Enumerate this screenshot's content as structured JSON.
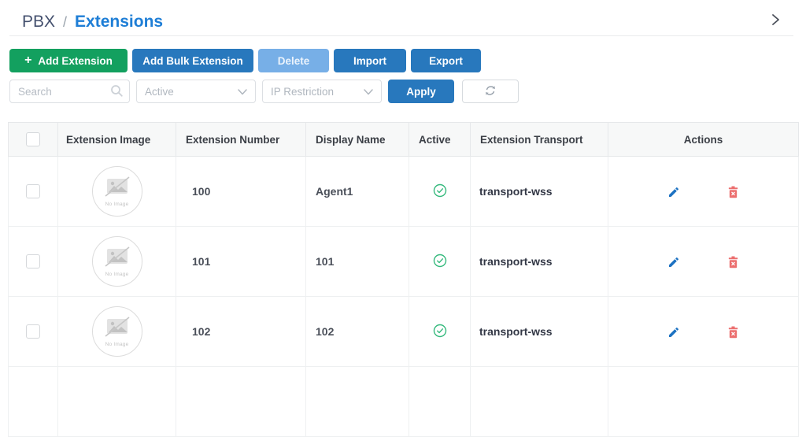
{
  "breadcrumb": {
    "parent": "PBX",
    "separator": "/",
    "current": "Extensions"
  },
  "toolbar": {
    "add_extension_label": "Add Extension",
    "add_bulk_extension_label": "Add Bulk Extension",
    "delete_label": "Delete",
    "import_label": "Import",
    "export_label": "Export"
  },
  "filters": {
    "search_placeholder": "Search",
    "status_selected": "Active",
    "ip_restriction_selected": "IP Restriction",
    "apply_label": "Apply"
  },
  "table": {
    "columns": {
      "image": "Extension Image",
      "number": "Extension Number",
      "display_name": "Display Name",
      "active": "Active",
      "transport": "Extension Transport",
      "actions": "Actions"
    },
    "no_image_label": "No Image",
    "rows": [
      {
        "extension_number": "100",
        "display_name": "Agent1",
        "active": "yes",
        "extension_transport": "transport-wss"
      },
      {
        "extension_number": "101",
        "display_name": "101",
        "active": "yes",
        "extension_transport": "transport-wss"
      },
      {
        "extension_number": "102",
        "display_name": "102",
        "active": "yes",
        "extension_transport": "transport-wss"
      }
    ]
  },
  "icons": {
    "plus": "+",
    "search": "search-icon",
    "chevron_down": "chevron-down-icon",
    "refresh": "refresh-icon",
    "active_check": "check-circle-icon",
    "edit": "pencil-icon",
    "delete": "trash-icon",
    "collapse": "chevron-right-icon",
    "no_image": "image-slash-icon"
  },
  "colors": {
    "primary_blue": "#2878bd",
    "success_green": "#13a05f",
    "disabled_blue": "#77afe7",
    "breadcrumb_blue": "#1e7ed6",
    "breadcrumb_dark": "#44506e",
    "danger_red": "#ec6f6f",
    "check_green": "#34b97c",
    "table_header_bg": "#f7f8f8",
    "border_gray": "#e6e8ea"
  }
}
